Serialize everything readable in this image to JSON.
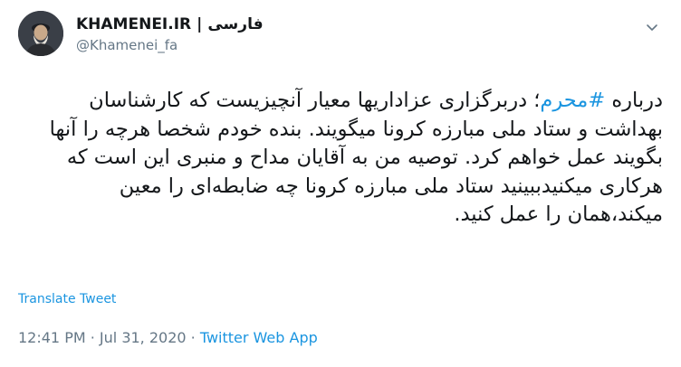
{
  "author": {
    "name": "KHAMENEI.IR",
    "separator": "|",
    "language_label": "فارسی",
    "handle": "@Khamenei_fa"
  },
  "tweet": {
    "text_prefix": "درباره ",
    "hashtag": "#محرم",
    "text_rest": "؛ دربرگزاری عزاداریها معیار آنچیزیست که کارشناسان بهداشت و ستاد ملی مبارزه کرونا میگویند. بنده خودم شخصا هرچه را آنها بگویند عمل خواهم کرد. توصیه من به آقایان مداح و منبری این است که هرکاری میکنیدببینید ستاد ملی مبارزه کرونا چه ضابطه‌ای را معین میکند،همان را عمل کنید."
  },
  "translate_label": "Translate Tweet",
  "meta": {
    "time": "12:41 PM",
    "dot": " · ",
    "date": "Jul 31, 2020",
    "app": "Twitter Web App"
  },
  "icons": {
    "menu": "chevron-down-icon",
    "avatar": "avatar"
  },
  "colors": {
    "link": "#1b95e0",
    "secondary": "#657786",
    "text": "#14171a"
  }
}
